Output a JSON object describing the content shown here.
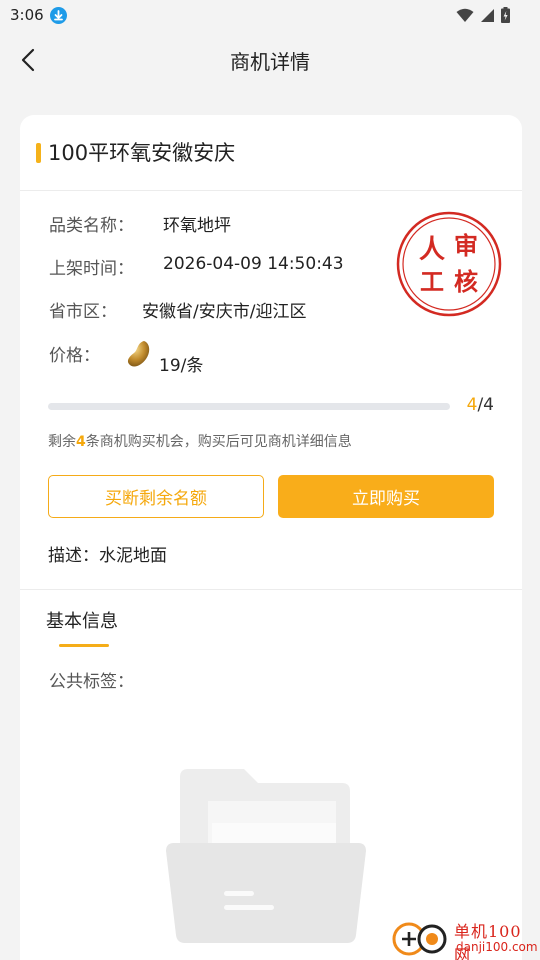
{
  "status_bar": {
    "time": "3:06"
  },
  "header": {
    "title": "商机详情"
  },
  "detail": {
    "title": "100平环氧安徽安庆",
    "category_label": "品类名称：",
    "category_value": "环氧地坪",
    "listed_label": "上架时间：",
    "listed_value": "2026-04-09 14:50:43",
    "region_label": "省市区：",
    "region_value": "安徽省/安庆市/迎江区",
    "price_label": "价格：",
    "price_value": "19/条",
    "seal_text": "人审工核",
    "progress": {
      "current": "4",
      "total": "/4",
      "remaining_fraction": 1.0
    },
    "remain_tip_prefix": "剩余",
    "remain_tip_count": "4",
    "remain_tip_suffix": "条商机购买机会，购买后可见商机详细信息",
    "btn_buyout": "买断剩余名额",
    "btn_buy_now": "立即购买",
    "desc": "描述：水泥地面"
  },
  "basic_info": {
    "tab_label": "基本信息",
    "public_tags_label": "公共标签："
  },
  "watermark": {
    "name": "单机100网",
    "url": "danji100.com"
  },
  "colors": {
    "accent": "#f9ad1a",
    "seal_red": "#d32a22",
    "page_bg": "#f3f3f3"
  }
}
